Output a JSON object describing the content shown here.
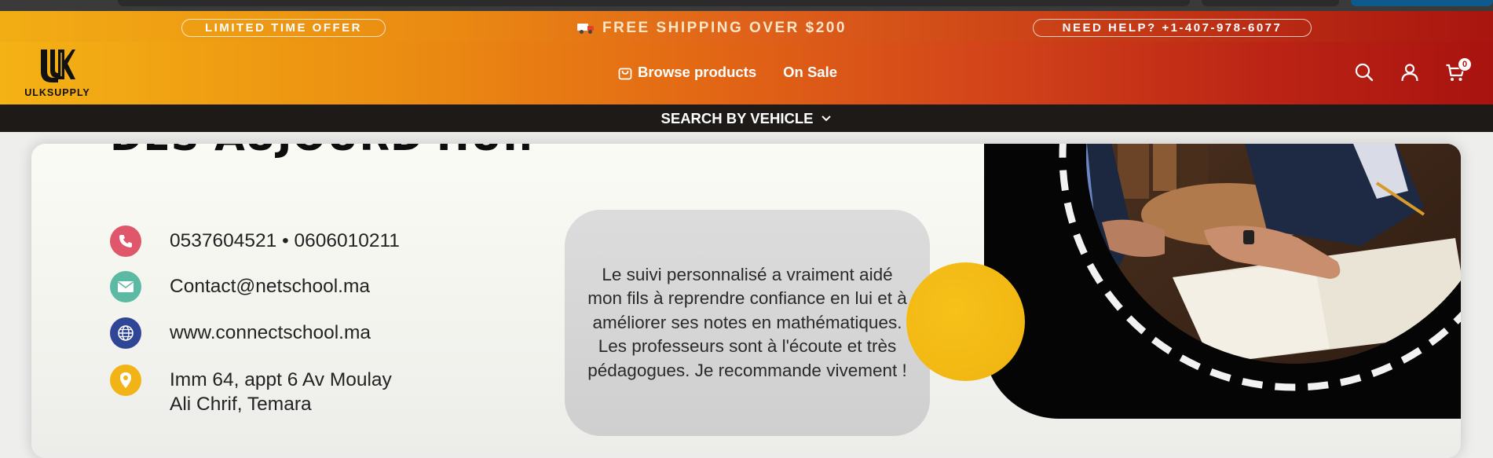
{
  "announcement": {
    "offer_label": "LIMITED TIME OFFER",
    "shipping_text": "FREE SHIPPING OVER $200",
    "help_label": "NEED HELP? +1-407-978-6077"
  },
  "header": {
    "logo_text": "ULKSUPPLY",
    "nav": [
      {
        "label": "Browse products",
        "icon": "shopping-bag-icon"
      },
      {
        "label": "On Sale"
      }
    ],
    "cart_count": "0"
  },
  "vehicle_bar": {
    "label": "SEARCH BY VEHICLE"
  },
  "content": {
    "heading": "DÈS AUJOURD'HUI.",
    "contacts": [
      {
        "icon": "phone-icon",
        "color": "#e0566a",
        "text": "0537604521 • 0606010211"
      },
      {
        "icon": "mail-icon",
        "color": "#5cb9a4",
        "text": "Contact@netschool.ma"
      },
      {
        "icon": "globe-icon",
        "color": "#2f4596",
        "text": "www.connectschool.ma"
      },
      {
        "icon": "location-pin-icon",
        "color": "#f2b316",
        "text_line1": "Imm 64, appt 6 Av Moulay",
        "text_line2": "Ali Chrif, Temara"
      }
    ],
    "testimonial": "Le suivi personnalisé a vraiment aidé mon fils à reprendre confiance en lui et à améliorer ses notes en mathématiques. Les professeurs sont à l'écoute et très pédagogues. Je recommande vivement !"
  },
  "colors": {
    "accent_yellow": "#f2b316",
    "header_start": "#f4b214",
    "header_end": "#a8130f",
    "vehicle_bar": "#1e1a17"
  }
}
